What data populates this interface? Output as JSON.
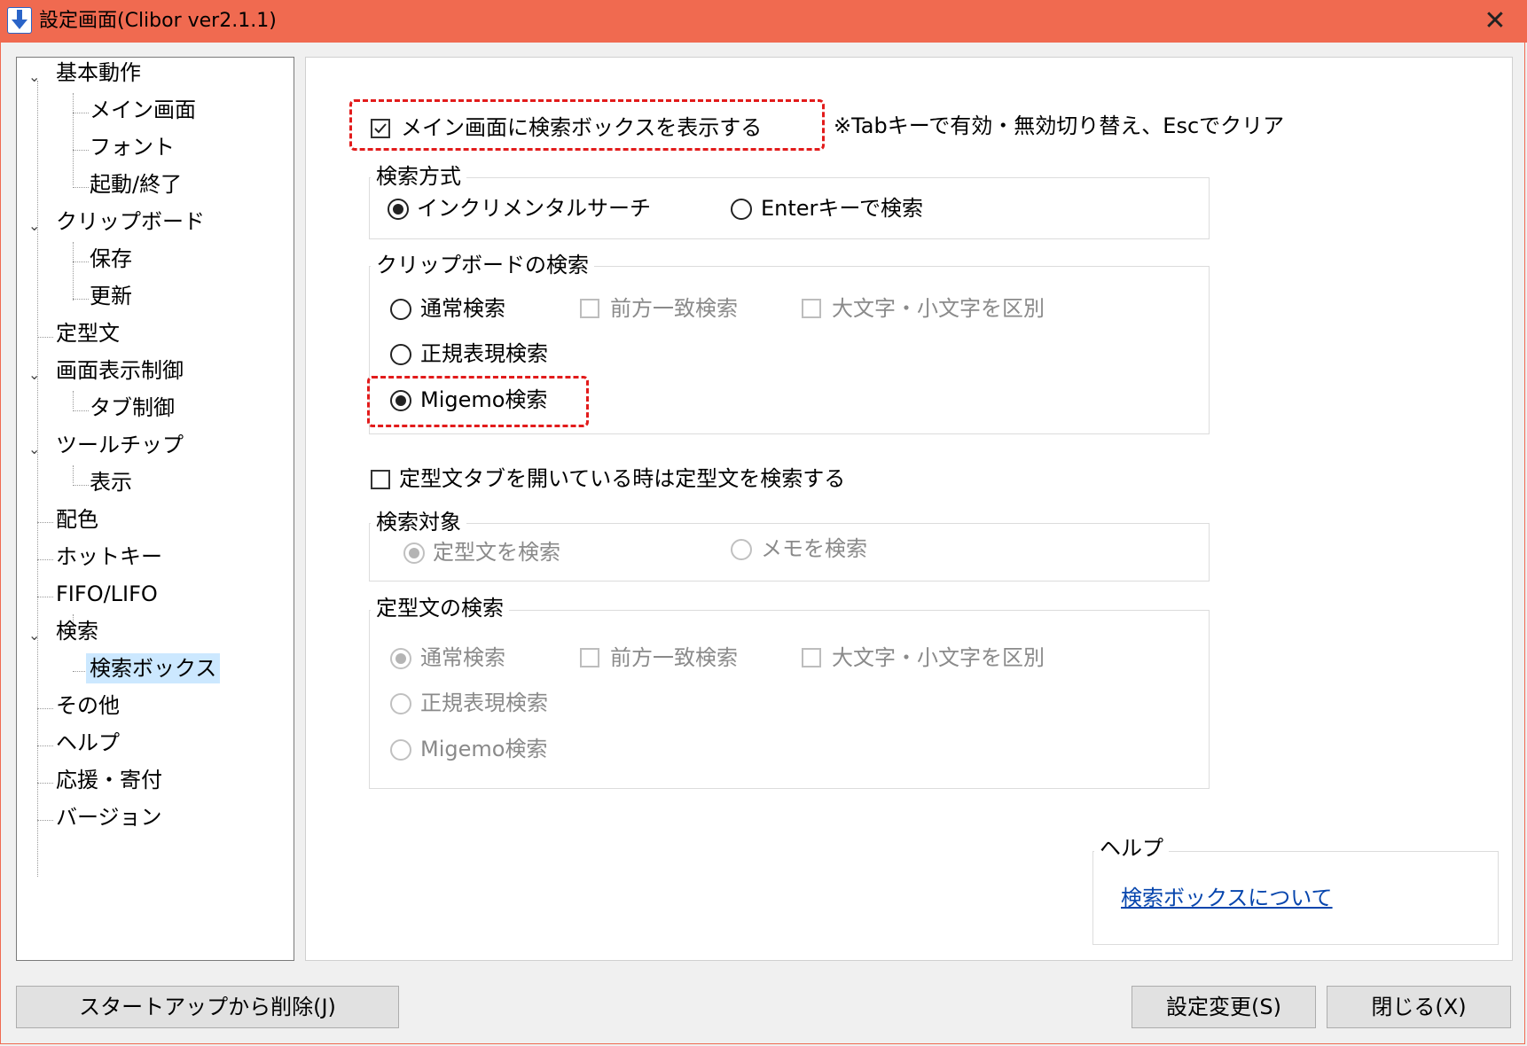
{
  "window": {
    "title": "設定画面(Clibor ver2.1.1)",
    "close_glyph": "✕"
  },
  "tree": {
    "items": [
      {
        "label": "基本動作",
        "level": 0,
        "expanded": true
      },
      {
        "label": "メイン画面",
        "level": 1
      },
      {
        "label": "フォント",
        "level": 1
      },
      {
        "label": "起動/終了",
        "level": 1
      },
      {
        "label": "クリップボード",
        "level": 0,
        "expanded": true
      },
      {
        "label": "保存",
        "level": 1
      },
      {
        "label": "更新",
        "level": 1
      },
      {
        "label": "定型文",
        "level": 0
      },
      {
        "label": "画面表示制御",
        "level": 0,
        "expanded": true
      },
      {
        "label": "タブ制御",
        "level": 1
      },
      {
        "label": "ツールチップ",
        "level": 0,
        "expanded": true
      },
      {
        "label": "表示",
        "level": 1
      },
      {
        "label": "配色",
        "level": 0
      },
      {
        "label": "ホットキー",
        "level": 0
      },
      {
        "label": "FIFO/LIFO",
        "level": 0
      },
      {
        "label": "検索",
        "level": 0,
        "expanded": true
      },
      {
        "label": "検索ボックス",
        "level": 1,
        "selected": true
      },
      {
        "label": "その他",
        "level": 0
      },
      {
        "label": "ヘルプ",
        "level": 0
      },
      {
        "label": "応援・寄付",
        "level": 0
      },
      {
        "label": "バージョン",
        "level": 0
      }
    ]
  },
  "main": {
    "show_search_box": {
      "label": "メイン画面に検索ボックスを表示する",
      "checked": true
    },
    "note": "※Tabキーで有効・無効切り替え、Escでクリア",
    "search_method": {
      "title": "検索方式",
      "options": [
        {
          "label": "インクリメンタルサーチ",
          "selected": true
        },
        {
          "label": "Enterキーで検索",
          "selected": false
        }
      ]
    },
    "clipboard_search": {
      "title": "クリップボードの検索",
      "normal": {
        "label": "通常検索",
        "selected": false
      },
      "prefix": {
        "label": "前方一致検索",
        "checked": false,
        "enabled": false
      },
      "case": {
        "label": "大文字・小文字を区別",
        "checked": false,
        "enabled": false
      },
      "regex": {
        "label": "正規表現検索",
        "selected": false
      },
      "migemo": {
        "label": "Migemo検索",
        "selected": true
      }
    },
    "template_search_toggle": {
      "label": "定型文タブを開いている時は定型文を検索する",
      "checked": false
    },
    "search_target": {
      "title": "検索対象",
      "options": [
        {
          "label": "定型文を検索",
          "selected": true,
          "enabled": false
        },
        {
          "label": "メモを検索",
          "selected": false,
          "enabled": false
        }
      ]
    },
    "template_search": {
      "title": "定型文の検索",
      "normal": {
        "label": "通常検索",
        "selected": true,
        "enabled": false
      },
      "prefix": {
        "label": "前方一致検索",
        "checked": false,
        "enabled": false
      },
      "case": {
        "label": "大文字・小文字を区別",
        "checked": false,
        "enabled": false
      },
      "regex": {
        "label": "正規表現検索",
        "selected": false,
        "enabled": false
      },
      "migemo": {
        "label": "Migemo検索",
        "selected": false,
        "enabled": false
      }
    },
    "help": {
      "title": "ヘルプ",
      "link": "検索ボックスについて"
    }
  },
  "buttons": {
    "startup_remove": "スタートアップから削除(J)",
    "apply": "設定変更(S)",
    "close": "閉じる(X)"
  },
  "colors": {
    "titlebar": "#f06a50",
    "highlight": "#e21b1b",
    "selection": "#cce8ff",
    "link": "#0645ad"
  }
}
